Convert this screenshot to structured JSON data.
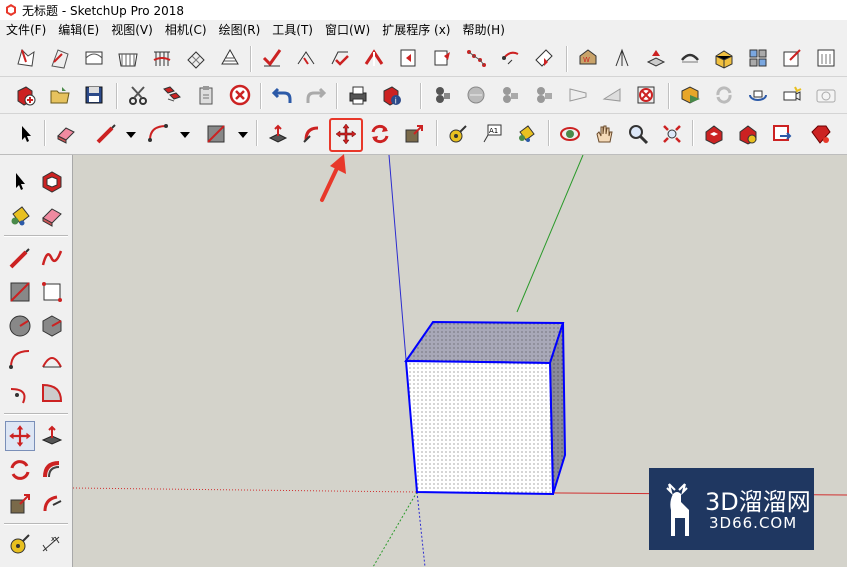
{
  "window": {
    "title": "无标题 - SketchUp Pro 2018"
  },
  "menubar": {
    "items": [
      {
        "label": "文件(F)"
      },
      {
        "label": "编辑(E)"
      },
      {
        "label": "视图(V)"
      },
      {
        "label": "相机(C)"
      },
      {
        "label": "绘图(R)"
      },
      {
        "label": "工具(T)"
      },
      {
        "label": "窗口(W)"
      },
      {
        "label": "扩展程序 (x)"
      },
      {
        "label": "帮助(H)"
      }
    ]
  },
  "toolbar": {
    "highlighted_tool": "move-tool",
    "highlight_color": "#e8382a"
  },
  "annotation": {
    "arrow_color": "#e8382a"
  },
  "viewport": {
    "background": "#d4d3cb",
    "axis_colors": {
      "red": "#d03030",
      "green": "#2a9a2a",
      "blue": "#2c2ccf"
    },
    "selection_color": "#0000ff"
  },
  "watermark": {
    "title": "3D溜溜网",
    "subtitle": "3D66.COM",
    "background": "#1f3761"
  }
}
